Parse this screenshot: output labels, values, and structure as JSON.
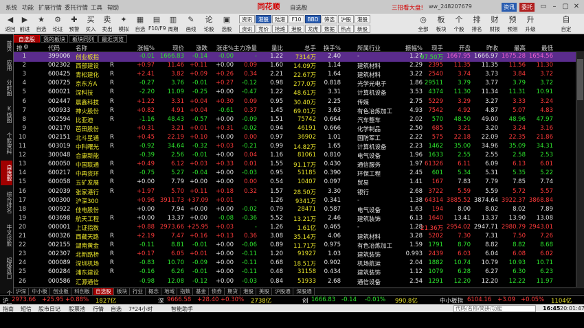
{
  "menu": {
    "items": [
      "系统",
      "功能",
      "扩展行情",
      "委托行情",
      "工具",
      "帮助"
    ]
  },
  "window": {
    "brand": "同花顺",
    "title": "自选股",
    "promo": "三招看大盘!",
    "user": "ww_248207679",
    "news": "资讯",
    "commission": "委托",
    "controls": [
      "▭",
      "–",
      "▢",
      "✕"
    ]
  },
  "toolbar": {
    "buttons": [
      {
        "icon": "◀",
        "label": "返回",
        "name": "back-icon"
      },
      {
        "icon": "▶",
        "label": "前进",
        "name": "forward-icon"
      },
      {
        "icon": "★",
        "label": "自选",
        "name": "watchlist-icon"
      },
      {
        "icon": "⚙",
        "label": "论证",
        "name": "verify-icon"
      },
      {
        "icon": "✚",
        "label": "预警",
        "name": "alert-icon"
      },
      {
        "icon": "买",
        "label": "买入",
        "name": "buy-icon"
      },
      {
        "icon": "卖",
        "label": "卖出",
        "name": "sell-icon"
      },
      {
        "icon": "✦",
        "label": "模拟",
        "name": "simulate-icon"
      },
      {
        "icon": "▦",
        "label": "自选",
        "name": "select-icon"
      },
      {
        "icon": "▤",
        "label": "F10/F9",
        "name": "f10-icon"
      },
      {
        "icon": "▥",
        "label": "周期",
        "name": "period-icon"
      },
      {
        "icon": "✎",
        "label": "画线",
        "name": "draw-icon"
      },
      {
        "icon": "论",
        "label": "论股",
        "name": "discuss-icon"
      },
      {
        "icon": "▣",
        "label": "选股",
        "name": "screen-icon"
      }
    ],
    "grid1": [
      "资讯",
      "港股",
      "陆港",
      "F10",
      "BBD",
      "筛选",
      "沪股",
      "港股"
    ],
    "grid2": [
      "资讯",
      "竞价",
      "抢滩",
      "港股",
      "龙虎",
      "数据",
      "热点",
      "新股"
    ],
    "right_buttons": [
      {
        "icon": "◎",
        "label": "全部"
      },
      {
        "icon": "板",
        "label": "板块"
      },
      {
        "icon": "个",
        "label": "个股"
      },
      {
        "icon": "排",
        "label": "排名"
      },
      {
        "icon": "财",
        "label": "财报"
      },
      {
        "icon": "预",
        "label": "预测"
      },
      {
        "icon": "升",
        "label": "升级"
      },
      {
        "icon": "自",
        "label": "自定"
      }
    ],
    "tail": [
      "报价",
      "大单",
      "指数",
      "期货",
      "相对",
      "报表",
      "港股",
      "美股"
    ]
  },
  "sidetabs": [
    "首页",
    "应用",
    "分时图",
    "K线图",
    "个股资料",
    "自选股",
    "综合排名",
    "牛叉诊股",
    "超级盘口",
    "个股全景"
  ],
  "subtabs": [
    "自选股",
    "我的板块",
    "板块同列",
    "最近浏览"
  ],
  "columns": [
    "代码",
    "名称",
    "",
    "涨幅%",
    "现价",
    "涨跌",
    "涨速%",
    "主力净量",
    "量比",
    "总手",
    "换手%",
    "所属行业",
    "振幅%",
    "现手",
    "开盘",
    "昨收",
    "最高",
    "最低"
  ],
  "rows": [
    {
      "i": "1",
      "code": "399006",
      "name": "创业板指",
      "tag": "",
      "pct": "-0.01",
      "price": "1666.83",
      "chg": "-0.14",
      "spd": "-0.00",
      "main": "-",
      "lb": "1.22",
      "vol": "7314万",
      "turn": "2.40",
      "ind": "-",
      "amp": "1.27",
      "hand": "97.50万",
      "open": "1667.95",
      "prev": "1666.97",
      "high": "1675.28",
      "low": "1654.56",
      "dir": "g"
    },
    {
      "i": "2",
      "code": "002302",
      "name": "西部建设",
      "tag": "R",
      "pct": "+0.97",
      "price": "11.46",
      "chg": "+0.11",
      "spd": "+0.00",
      "main": "0.09",
      "lb": "1.60",
      "vol": "14.09万",
      "turn": "1.14",
      "ind": "建筑材料",
      "amp": "2.29",
      "hand": "2395",
      "open": "11.35",
      "prev": "11.35",
      "high": "11.56",
      "low": "11.30",
      "dir": "r"
    },
    {
      "i": "3",
      "code": "600425",
      "name": "青松建化",
      "tag": "R",
      "pct": "+2.41",
      "price": "3.82",
      "chg": "+0.09",
      "spd": "+0.26",
      "main": "0.34",
      "lb": "2.21",
      "vol": "22.67万",
      "turn": "1.64",
      "ind": "建筑材料",
      "amp": "3.22",
      "hand": "2540",
      "open": "3.74",
      "prev": "3.73",
      "high": "3.84",
      "low": "3.72",
      "dir": "r"
    },
    {
      "i": "4",
      "code": "000725",
      "name": "京东方A",
      "tag": "R",
      "pct": "-0.27",
      "price": "3.76",
      "chg": "-0.01",
      "spd": "+0.27",
      "main": "-0.12",
      "lb": "0.98",
      "vol": "277.0万",
      "turn": "0.818",
      "ind": "光学光电子",
      "amp": "1.86",
      "hand": "29511",
      "open": "3.79",
      "prev": "3.77",
      "high": "3.79",
      "low": "3.72",
      "dir": "g"
    },
    {
      "i": "5",
      "code": "600021",
      "name": "深科技",
      "tag": "R",
      "pct": "-2.20",
      "price": "11.09",
      "chg": "-0.25",
      "spd": "+0.00",
      "main": "-0.47",
      "lb": "1.22",
      "vol": "48.61万",
      "turn": "3.31",
      "ind": "计算机设备",
      "amp": "3.53",
      "hand": "4374",
      "open": "11.30",
      "prev": "11.34",
      "high": "11.31",
      "low": "10.91",
      "dir": "g"
    },
    {
      "i": "6",
      "code": "002447",
      "name": "晨鑫科技",
      "tag": "R",
      "pct": "+1.22",
      "price": "3.31",
      "chg": "+0.04",
      "spd": "+0.30",
      "main": "0.09",
      "lb": "0.95",
      "vol": "30.40万",
      "turn": "2.25",
      "ind": "传媒",
      "amp": "2.75",
      "hand": "5229",
      "open": "3.29",
      "prev": "3.27",
      "high": "3.33",
      "low": "3.24",
      "dir": "r"
    },
    {
      "i": "7",
      "code": "000933",
      "name": "神火股份",
      "tag": "R",
      "pct": "+0.82",
      "price": "4.91",
      "chg": "+0.04",
      "spd": "-0.61",
      "main": "0.37",
      "lb": "1.45",
      "vol": "69.01万",
      "turn": "3.63",
      "ind": "有色冶炼加工",
      "amp": "4.93",
      "hand": "7542",
      "open": "4.92",
      "prev": "4.87",
      "high": "5.07",
      "low": "4.83",
      "dir": "r"
    },
    {
      "i": "8",
      "code": "002594",
      "name": "比亚迪",
      "tag": "R",
      "pct": "-1.16",
      "price": "48.43",
      "chg": "-0.57",
      "spd": "+0.00",
      "main": "-0.09",
      "lb": "1.51",
      "vol": "75742",
      "turn": "0.664",
      "ind": "汽车整车",
      "amp": "2.02",
      "hand": "570",
      "open": "48.50",
      "prev": "49.00",
      "high": "48.96",
      "low": "47.97",
      "dir": "g"
    },
    {
      "i": "9",
      "code": "002170",
      "name": "芭田股份",
      "tag": "",
      "pct": "+0.31",
      "price": "3.21",
      "chg": "+0.01",
      "spd": "+0.31",
      "main": "-0.02",
      "lb": "0.94",
      "vol": "46191",
      "turn": "0.666",
      "ind": "化学制品",
      "amp": "2.50",
      "hand": "685",
      "open": "3.21",
      "prev": "3.20",
      "high": "3.24",
      "low": "3.16",
      "dir": "r"
    },
    {
      "i": "10",
      "code": "002151",
      "name": "北斗星通",
      "tag": "R",
      "pct": "+0.45",
      "price": "22.19",
      "chg": "+0.10",
      "spd": "+0.00",
      "main": "0.00",
      "lb": "0.97",
      "vol": "36902",
      "turn": "1.01",
      "ind": "国防军工",
      "amp": "2.22",
      "hand": "575",
      "open": "22.18",
      "prev": "22.09",
      "high": "22.35",
      "low": "21.86",
      "dir": "r"
    },
    {
      "i": "11",
      "code": "603019",
      "name": "中科曙光",
      "tag": "R",
      "pct": "-0.92",
      "price": "34.64",
      "chg": "-0.32",
      "spd": "+0.03",
      "main": "-0.21",
      "lb": "0.99",
      "vol": "14.82万",
      "turn": "1.65",
      "ind": "计算机设备",
      "amp": "2.23",
      "hand": "1462",
      "open": "35.00",
      "prev": "34.96",
      "high": "35.09",
      "low": "34.31",
      "dir": "g"
    },
    {
      "i": "12",
      "code": "300048",
      "name": "合康新能",
      "tag": "",
      "pct": "-0.39",
      "price": "2.56",
      "chg": "-0.01",
      "spd": "+0.00",
      "main": "0.04",
      "lb": "1.16",
      "vol": "81061",
      "turn": "0.810",
      "ind": "电气设备",
      "amp": "1.96",
      "hand": "1633",
      "open": "2.55",
      "prev": "2.55",
      "high": "2.58",
      "low": "2.53",
      "dir": "g"
    },
    {
      "i": "13",
      "code": "600050",
      "name": "中国联通",
      "tag": "R",
      "pct": "+0.49",
      "price": "6.12",
      "chg": "+0.03",
      "spd": "+0.33",
      "main": "0.01",
      "lb": "1.55",
      "vol": "91.17万",
      "turn": "0.430",
      "ind": "通信服务",
      "amp": "1.97",
      "hand": "61326",
      "open": "6.11",
      "prev": "6.09",
      "high": "6.13",
      "low": "6.01",
      "dir": "r"
    },
    {
      "i": "14",
      "code": "600217",
      "name": "中再资环",
      "tag": "R",
      "pct": "-0.75",
      "price": "5.27",
      "chg": "-0.04",
      "spd": "+0.00",
      "main": "-0.03",
      "lb": "0.95",
      "vol": "51185",
      "turn": "0.390",
      "ind": "环保工程",
      "amp": "2.45",
      "hand": "601",
      "open": "5.34",
      "prev": "5.31",
      "high": "5.35",
      "low": "5.22",
      "dir": "g"
    },
    {
      "i": "15",
      "code": "600058",
      "name": "五矿发展",
      "tag": "R",
      "pct": "+0.00",
      "price": "7.79",
      "chg": "+0.00",
      "spd": "+0.00",
      "main": "0.00",
      "lb": "0.54",
      "vol": "10407",
      "turn": "0.097",
      "ind": "贸易",
      "amp": "1.41",
      "hand": "167",
      "open": "7.83",
      "prev": "7.79",
      "high": "7.85",
      "low": "7.74",
      "dir": "w"
    },
    {
      "i": "16",
      "code": "002039",
      "name": "张家港行",
      "tag": "R",
      "pct": "+1.97",
      "price": "5.70",
      "chg": "+0.11",
      "spd": "+0.18",
      "main": "0.32",
      "lb": "1.57",
      "vol": "28.50万",
      "turn": "3.30",
      "ind": "银行",
      "amp": "2.68",
      "hand": "3722",
      "open": "5.59",
      "prev": "5.59",
      "high": "5.72",
      "low": "5.57",
      "dir": "r"
    },
    {
      "i": "17",
      "code": "000300",
      "name": "沪深300",
      "tag": "",
      "pct": "+0.96",
      "price": "3911.73",
      "chg": "+37.09",
      "spd": "+0.01",
      "main": "-",
      "lb": "1.26",
      "vol": "9341万",
      "turn": "0.341",
      "ind": "-",
      "amp": "1.38",
      "hand": "64314",
      "open": "3885.52",
      "prev": "3874.64",
      "high": "3922.37",
      "low": "3868.84",
      "dir": "r"
    },
    {
      "i": "18",
      "code": "000922",
      "name": "佳电股份",
      "tag": "",
      "pct": "+0.00",
      "price": "7.94",
      "chg": "+0.00",
      "spd": "+0.00",
      "main": "-0.02",
      "lb": "0.79",
      "vol": "28471",
      "turn": "0.587",
      "ind": "电气设备",
      "amp": "1.63",
      "hand": "194",
      "open": "8.00",
      "prev": "8.02",
      "high": "8.02",
      "low": "7.89",
      "dir": "w"
    },
    {
      "i": "19",
      "code": "603698",
      "name": "航天工程",
      "tag": "R",
      "pct": "+0.00",
      "price": "13.37",
      "chg": "+0.00",
      "spd": "-0.08",
      "main": "-0.36",
      "lb": "5.52",
      "vol": "13.21万",
      "turn": "2.46",
      "ind": "建筑装饰",
      "amp": "6.13",
      "hand": "1640",
      "open": "13.41",
      "prev": "13.37",
      "high": "13.90",
      "low": "13.08",
      "dir": "w"
    },
    {
      "i": "20",
      "code": "000001",
      "name": "上证指数",
      "tag": "",
      "pct": "+0.88",
      "price": "2973.66",
      "chg": "+25.95",
      "spd": "+0.03",
      "main": "-",
      "lb": "1.26",
      "vol": "1.61亿",
      "turn": "0.465",
      "ind": "-",
      "amp": "1.28",
      "hand": "21.36万",
      "open": "2954.02",
      "prev": "2947.71",
      "high": "2980.79",
      "low": "2943.01",
      "dir": "r"
    },
    {
      "i": "21",
      "code": "600326",
      "name": "西藏天路",
      "tag": "R",
      "pct": "+2.19",
      "price": "7.47",
      "chg": "+0.16",
      "spd": "+0.13",
      "main": "0.36",
      "lb": "3.08",
      "vol": "35.14万",
      "turn": "4.06",
      "ind": "建筑材料",
      "amp": "3.28",
      "hand": "5202",
      "open": "7.30",
      "prev": "7.31",
      "high": "7.50",
      "low": "7.26",
      "dir": "r"
    },
    {
      "i": "22",
      "code": "002155",
      "name": "湖南黄金",
      "tag": "R",
      "pct": "-0.11",
      "price": "8.81",
      "chg": "-0.01",
      "spd": "+0.00",
      "main": "-0.06",
      "lb": "0.89",
      "vol": "11.71万",
      "turn": "0.975",
      "ind": "有色冶炼加工",
      "amp": "1.59",
      "hand": "1791",
      "open": "8.70",
      "prev": "8.82",
      "high": "8.82",
      "low": "8.68",
      "dir": "g"
    },
    {
      "i": "23",
      "code": "002307",
      "name": "北新路桥",
      "tag": "R",
      "pct": "+0.17",
      "price": "6.05",
      "chg": "+0.01",
      "spd": "+0.00",
      "main": "-0.11",
      "lb": "1.20",
      "vol": "91927",
      "turn": "1.03",
      "ind": "建筑装饰",
      "amp": "0.993",
      "hand": "2439",
      "open": "6.03",
      "prev": "6.04",
      "high": "6.08",
      "low": "6.02",
      "dir": "r"
    },
    {
      "i": "24",
      "code": "000089",
      "name": "深圳机场",
      "tag": "R",
      "pct": "-0.83",
      "price": "10.70",
      "chg": "-0.09",
      "spd": "+0.00",
      "main": "-0.11",
      "lb": "0.68",
      "vol": "18.51万",
      "turn": "0.902",
      "ind": "机场航运",
      "amp": "2.04",
      "hand": "1882",
      "open": "10.74",
      "prev": "10.79",
      "high": "10.93",
      "low": "10.71",
      "dir": "g"
    },
    {
      "i": "25",
      "code": "600284",
      "name": "浦东建设",
      "tag": "R",
      "pct": "-0.16",
      "price": "6.26",
      "chg": "-0.01",
      "spd": "+0.00",
      "main": "-0.11",
      "lb": "0.48",
      "vol": "31158",
      "turn": "0.434",
      "ind": "建筑装饰",
      "amp": "1.12",
      "hand": "1079",
      "open": "6.28",
      "prev": "6.27",
      "high": "6.30",
      "low": "6.23",
      "dir": "g"
    },
    {
      "i": "26",
      "code": "000586",
      "name": "汇源通信",
      "tag": "",
      "pct": "-0.98",
      "price": "12.08",
      "chg": "-0.12",
      "spd": "+0.00",
      "main": "-0.03",
      "lb": "0.84",
      "vol": "51933",
      "turn": "2.68",
      "ind": "通信设备",
      "amp": "2.54",
      "hand": "1291",
      "open": "12.20",
      "prev": "12.20",
      "high": "12.22",
      "low": "11.97",
      "dir": "g"
    }
  ],
  "bottom_tabs": [
    "沪深",
    "中小板",
    "创业板",
    "科创板",
    "自选股",
    "板块",
    "行业",
    "概念",
    "地域",
    "指数",
    "基金",
    "债券",
    "期货",
    "港股",
    "美股",
    "沪股通",
    "深股通"
  ],
  "index_bar": [
    {
      "label": "沪",
      "val": "2973.66",
      "chg": "+25.95",
      "pct": "+0.88%",
      "amt": "1827亿",
      "dir": "r"
    },
    {
      "label": "深",
      "val": "9666.58",
      "chg": "+28.40",
      "pct": "+0.30%",
      "amt": "2738亿",
      "dir": "r"
    },
    {
      "label": "创",
      "val": "1666.83",
      "chg": "-0.14",
      "pct": "-0.01%",
      "amt": "990.8亿",
      "dir": "g"
    },
    {
      "label": "中小板指",
      "val": "6104.16",
      "chg": "+3.09",
      "pct": "+0.05%",
      "amt": "1104亿",
      "dir": "r"
    }
  ],
  "status": {
    "items": [
      "指南",
      "短信",
      "股市日记",
      "股票池",
      "行情",
      "自选",
      "7*24小时",
      "智能助手"
    ],
    "search_placeholder": "代码/名称/简拼/功能",
    "time1": "16:45",
    "time2": "20:01:47"
  }
}
